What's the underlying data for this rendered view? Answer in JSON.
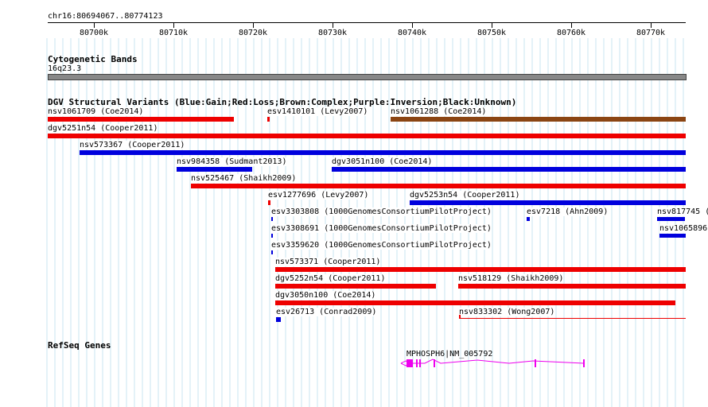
{
  "ruler": {
    "position": "chr16:80694067..80774123",
    "ticks": [
      "80700k",
      "80710k",
      "80720k",
      "80730k",
      "80740k",
      "80750k",
      "80760k",
      "80770k"
    ]
  },
  "cytoband": {
    "title": "Cytogenetic Bands",
    "band": "16q23.3"
  },
  "dgv": {
    "title": "DGV Structural Variants (Blue:Gain;Red:Loss;Brown:Complex;Purple:Inversion;Black:Unknown)",
    "colors": {
      "gain": "#0000dd",
      "loss": "#ee0000",
      "complex": "#8b4513"
    },
    "features": [
      {
        "label": "nsv1061709 (Coe2014)",
        "type": "loss"
      },
      {
        "label": "esv1410101 (Levy2007)",
        "type": "loss"
      },
      {
        "label": "nsv1061288 (Coe2014)",
        "type": "complex"
      },
      {
        "label": "dgv5251n54 (Cooper2011)",
        "type": "loss"
      },
      {
        "label": "nsv573367 (Cooper2011)",
        "type": "gain"
      },
      {
        "label": "nsv984358 (Sudmant2013)",
        "type": "gain"
      },
      {
        "label": "dgv3051n100 (Coe2014)",
        "type": "gain"
      },
      {
        "label": "nsv525467 (Shaikh2009)",
        "type": "loss"
      },
      {
        "label": "esv1277696 (Levy2007)",
        "type": "loss"
      },
      {
        "label": "dgv5253n54 (Cooper2011)",
        "type": "gain"
      },
      {
        "label": "esv3303808 (1000GenomesConsortiumPilotProject)",
        "type": "gain"
      },
      {
        "label": "esv7218 (Ahn2009)",
        "type": "gain"
      },
      {
        "label": "nsv817745 (",
        "type": "gain"
      },
      {
        "label": "esv3308691 (1000GenomesConsortiumPilotProject)",
        "type": "gain"
      },
      {
        "label": "nsv1065896",
        "type": "gain"
      },
      {
        "label": "esv3359620 (1000GenomesConsortiumPilotProject)",
        "type": "gain"
      },
      {
        "label": "nsv573371 (Cooper2011)",
        "type": "loss"
      },
      {
        "label": "dgv5252n54 (Cooper2011)",
        "type": "loss"
      },
      {
        "label": "nsv518129 (Shaikh2009)",
        "type": "loss"
      },
      {
        "label": "dgv3050n100 (Coe2014)",
        "type": "loss"
      },
      {
        "label": "esv26713 (Conrad2009)",
        "type": "gain"
      },
      {
        "label": "nsv833302 (Wong2007)",
        "type": "loss"
      }
    ]
  },
  "refseq": {
    "title": "RefSeq Genes",
    "gene_label": "MPHOSPH6|NM_005792",
    "gene_color": "#ee00ee"
  }
}
